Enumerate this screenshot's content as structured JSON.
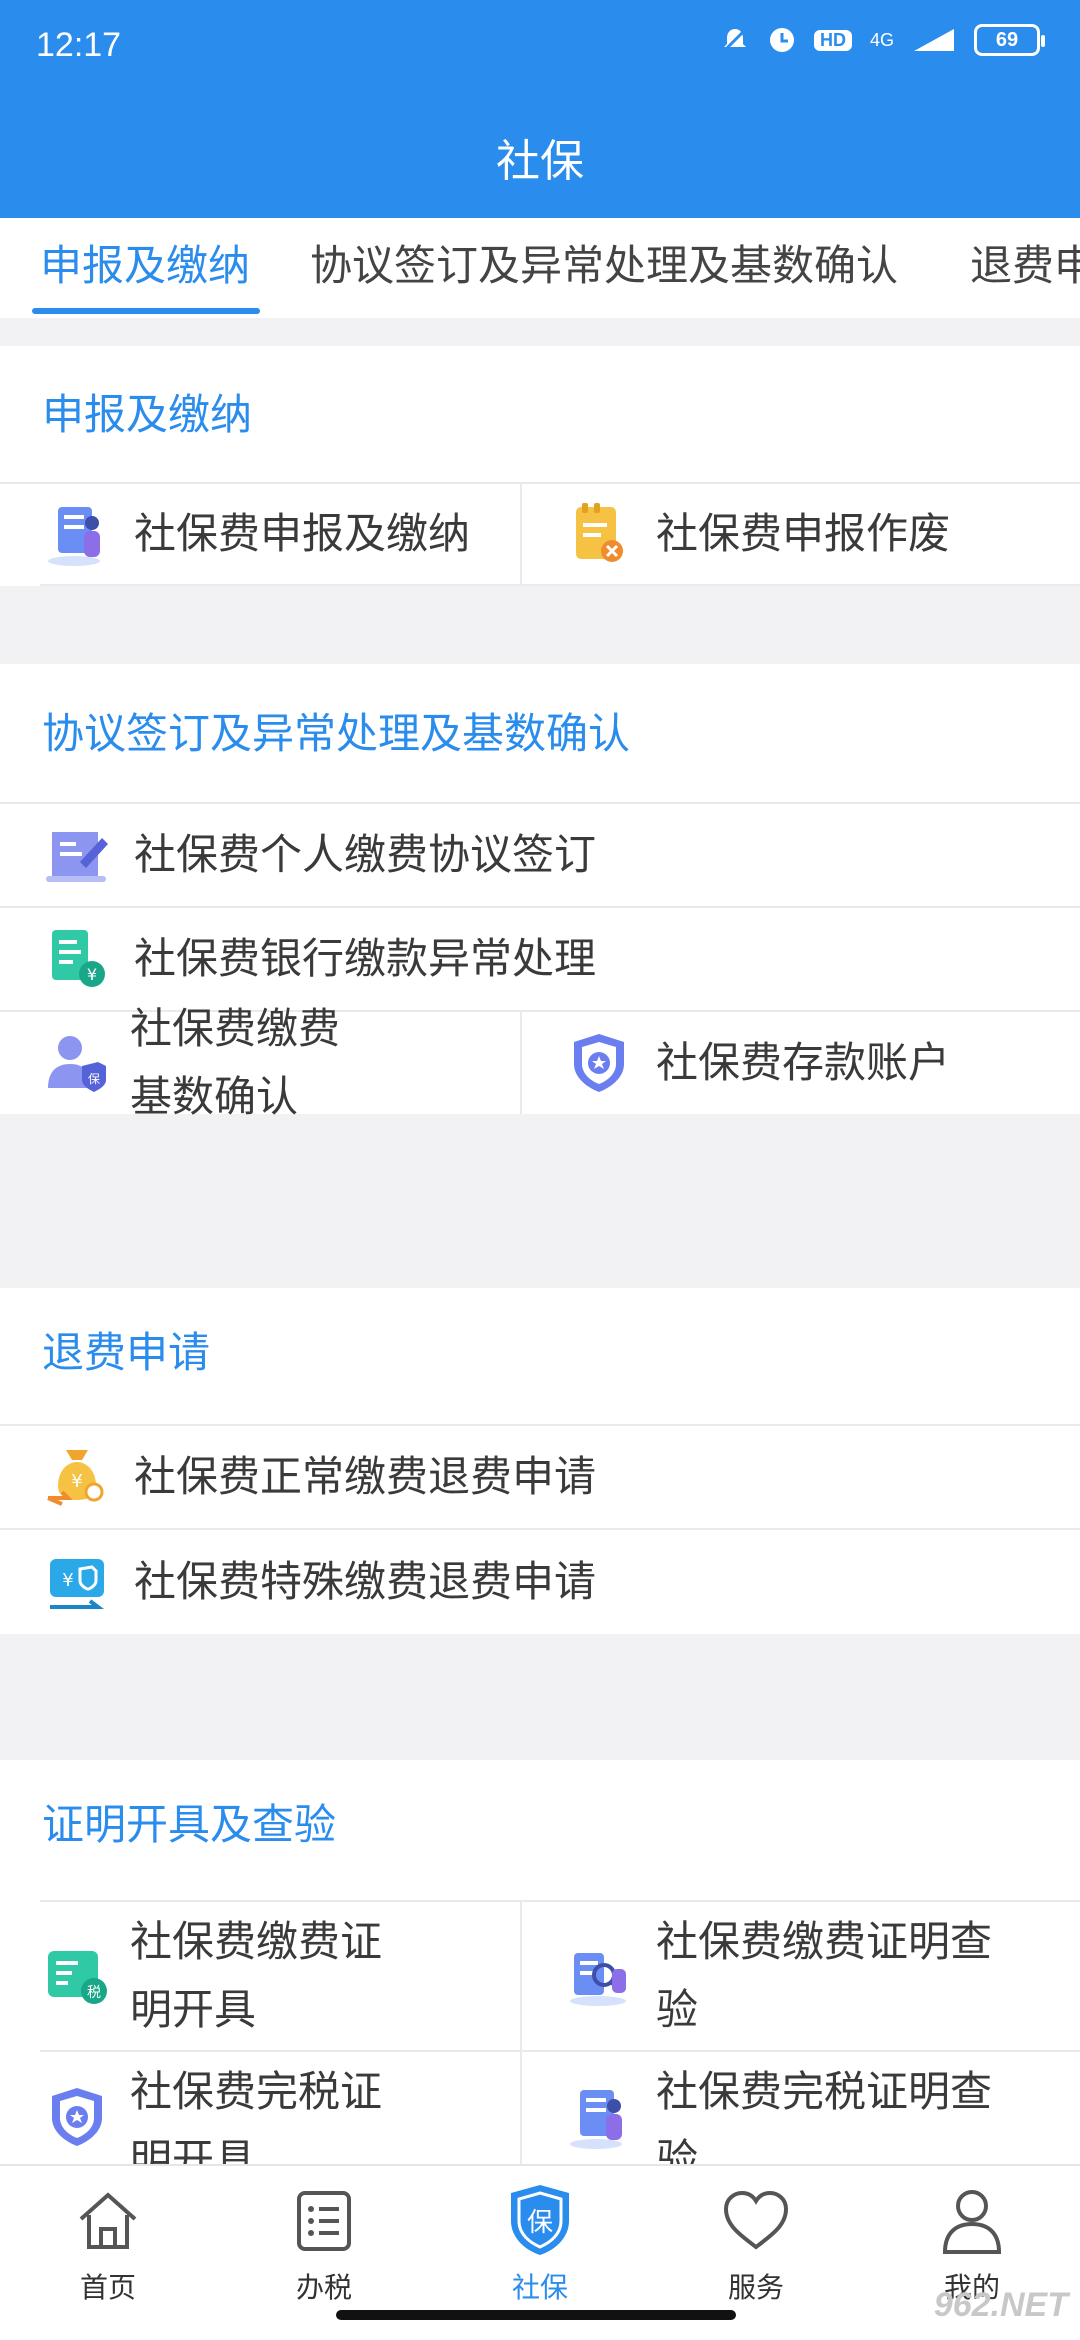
{
  "status": {
    "time": "12:17",
    "network": "4G",
    "hd": "HD",
    "battery": "69"
  },
  "header": {
    "title": "社保"
  },
  "tabs": [
    {
      "label": "申报及缴纳",
      "active": true
    },
    {
      "label": "协议签订及异常处理及基数确认",
      "active": false
    },
    {
      "label": "退费申",
      "active": false
    }
  ],
  "sections": {
    "declare": {
      "title": "申报及缴纳",
      "items": [
        "社保费申报及缴纳",
        "社保费申报作废"
      ]
    },
    "agreement": {
      "title": "协议签订及异常处理及基数确认",
      "items": [
        "社保费个人缴费协议签订",
        "社保费银行缴款异常处理",
        "社保费缴费基数确认",
        "社保费存款账户"
      ]
    },
    "refund": {
      "title": "退费申请",
      "items": [
        "社保费正常缴费退费申请",
        "社保费特殊缴费退费申请"
      ]
    },
    "certificate": {
      "title": "证明开具及查验",
      "items": [
        "社保费缴费证明开具",
        "社保费缴费证明查验",
        "社保费完税证明开具",
        "社保费完税证明查验"
      ]
    }
  },
  "bottom_nav": [
    {
      "label": "首页",
      "icon": "home-icon",
      "active": false
    },
    {
      "label": "办税",
      "icon": "list-icon",
      "active": false
    },
    {
      "label": "社保",
      "icon": "shield-bao-icon",
      "active": true,
      "badge": "保"
    },
    {
      "label": "服务",
      "icon": "heart-icon",
      "active": false
    },
    {
      "label": "我的",
      "icon": "user-icon",
      "active": false
    }
  ],
  "watermark": "962.NET",
  "colors": {
    "primary": "#2a8cec",
    "background": "#f2f2f5"
  }
}
